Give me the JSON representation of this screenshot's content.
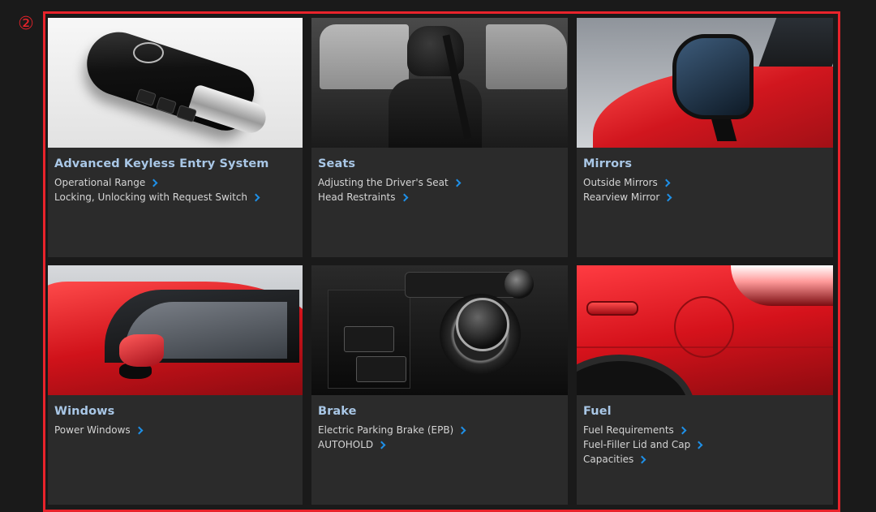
{
  "marker": "②",
  "cards": [
    {
      "title": "Advanced Keyless Entry System",
      "links": [
        "Operational Range",
        "Locking, Unlocking with Request Switch"
      ],
      "image": "smart-key-photo"
    },
    {
      "title": "Seats",
      "links": [
        "Adjusting the Driver's Seat",
        "Head Restraints"
      ],
      "image": "seat-photo"
    },
    {
      "title": "Mirrors",
      "links": [
        "Outside Mirrors",
        "Rearview Mirror"
      ],
      "image": "outside-mirror-photo"
    },
    {
      "title": "Windows",
      "links": [
        "Power Windows"
      ],
      "image": "window-photo"
    },
    {
      "title": "Brake",
      "links": [
        "Electric Parking Brake (EPB)",
        "AUTOHOLD"
      ],
      "image": "brake-console-photo"
    },
    {
      "title": "Fuel",
      "links": [
        "Fuel Requirements",
        "Fuel-Filler Lid and Cap",
        "Capacities"
      ],
      "image": "fuel-lid-photo"
    }
  ],
  "colors": {
    "highlight_border": "#e8232b",
    "title_blue": "#a9c7e6",
    "chevron_blue": "#1e90e8",
    "card_bg": "#2b2b2b"
  }
}
